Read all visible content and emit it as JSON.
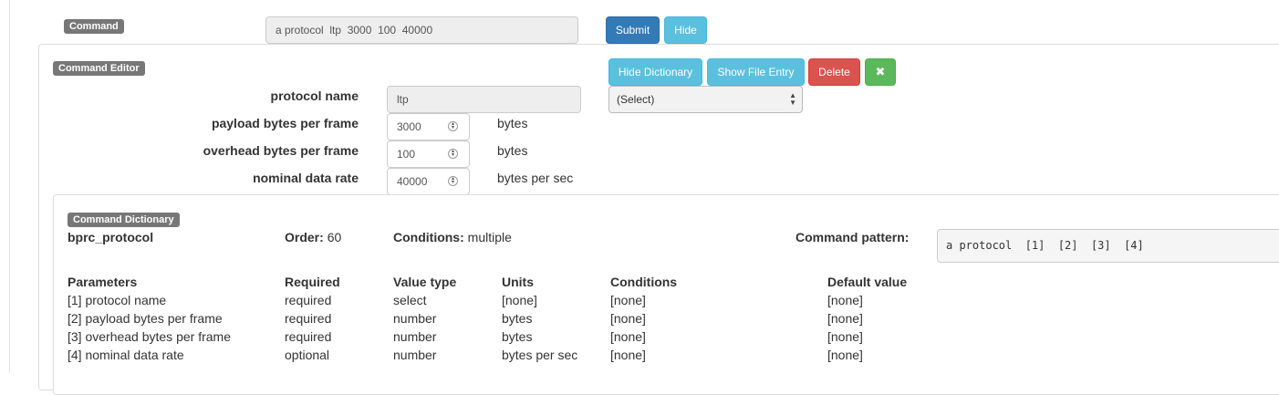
{
  "command": {
    "label": "Command",
    "value": "a protocol  ltp  3000  100  40000",
    "submit_label": "Submit",
    "hide_label": "Hide"
  },
  "editor": {
    "label": "Command Editor",
    "buttons": {
      "hide_dictionary": "Hide Dictionary",
      "show_file_entry": "Show File Entry",
      "delete": "Delete",
      "close_icon": "✖"
    },
    "select_value": "(Select)",
    "fields": [
      {
        "label": "protocol name",
        "value": "ltp",
        "unit": ""
      },
      {
        "label": "payload bytes per frame",
        "value": "3000",
        "unit": "bytes"
      },
      {
        "label": "overhead bytes per frame",
        "value": "100",
        "unit": "bytes"
      },
      {
        "label": "nominal data rate",
        "value": "40000",
        "unit": "bytes per sec"
      }
    ]
  },
  "dictionary": {
    "label": "Command Dictionary",
    "command_name": "bprc_protocol",
    "order_label": "Order:",
    "order_value": "60",
    "conditions_label": "Conditions:",
    "conditions_value": "multiple",
    "pattern_label": "Command pattern:",
    "pattern_value": "a protocol  [1]  [2]  [3]  [4]",
    "columns": [
      "Parameters",
      "Required",
      "Value type",
      "Units",
      "Conditions",
      "Default value"
    ],
    "rows": [
      [
        "[1] protocol name",
        "required",
        "select",
        "[none]",
        "[none]",
        "[none]"
      ],
      [
        "[2] payload bytes per frame",
        "required",
        "number",
        "bytes",
        "[none]",
        "[none]"
      ],
      [
        "[3] overhead bytes per frame",
        "required",
        "number",
        "bytes",
        "[none]",
        "[none]"
      ],
      [
        "[4] nominal data rate",
        "optional",
        "number",
        "bytes per sec",
        "[none]",
        "[none]"
      ]
    ]
  },
  "colors": {
    "primary": "#337ab7",
    "info": "#5bc0de",
    "danger": "#d9534f",
    "success": "#5cb85c",
    "badge": "#777777"
  }
}
